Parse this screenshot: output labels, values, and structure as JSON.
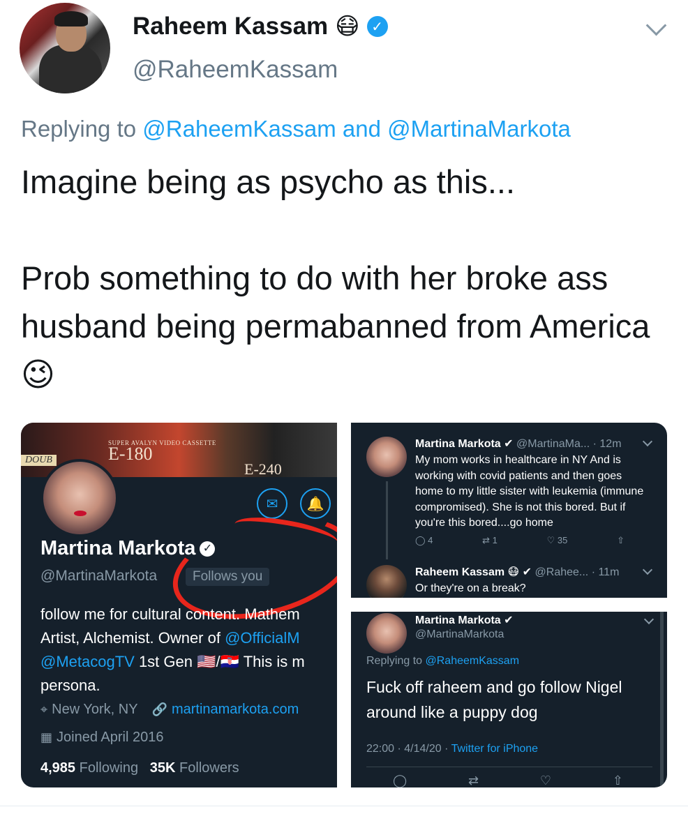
{
  "tweet": {
    "display_name": "Raheem Kassam",
    "name_emoji": "😷",
    "handle": "@RaheemKassam",
    "replying_prefix": "Replying to",
    "replying_mention_1": "@RaheemKassam",
    "replying_and": "and",
    "replying_mention_2": "@MartinaMarkota",
    "text_line_1": "Imagine being as psycho as this...",
    "text_line_2": "Prob something to do with her broke ass husband being permabanned from America 😉"
  },
  "profile_shot": {
    "banner_caption_small": "SUPER AVALYN VIDEO CASSETTE",
    "banner_caption_big": "E-180",
    "banner_caption_right": "E-240",
    "banner_caption_left": "DOUB",
    "name": "Martina Markota",
    "handle": "@MartinaMarkota",
    "follows_badge": "Follows you",
    "bio_line_1": "follow me for cultural content. Mathem",
    "bio_line_2a": "Artist, Alchemist. Owner of ",
    "bio_line_2b": "@OfficialM",
    "bio_line_3a": "@MetacogTV",
    "bio_line_3b": " 1st Gen 🇺🇸/🇭🇷  This is m",
    "bio_line_4": "persona.",
    "location": "New York, NY",
    "website": "martinamarkota.com",
    "joined": "Joined April 2016",
    "following_count": "4,985",
    "following_label": "Following",
    "followers_count": "35K",
    "followers_label": "Followers"
  },
  "thread_shot": {
    "tweet1_name": "Martina Markota",
    "tweet1_meta": "@MartinaMa... · 12m",
    "tweet1_text": "My mom works in healthcare in NY And is working with covid patients and then goes home to my little sister with leukemia (immune compromised). She is not this bored. But if you're this bored....go home",
    "reply_count": "4",
    "retweet_count": "1",
    "like_count": "35",
    "tweet2_name": "Raheem Kassam 😷",
    "tweet2_meta": "@Rahee... · 11m",
    "tweet2_text": "Or they're on a break?"
  },
  "detail_shot": {
    "name": "Martina Markota",
    "handle": "@MartinaMarkota",
    "replying_prefix": "Replying to",
    "replying_mention": "@RaheemKassam",
    "text": "Fuck off raheem and go follow Nigel around like a puppy dog",
    "timestamp": "22:00 · 4/14/20 ·",
    "client": "Twitter for iPhone"
  },
  "icons": {
    "verified": "verified-badge-icon",
    "chevron": "chevron-down-icon",
    "mail": "mail-icon",
    "bell": "notification-bell-icon",
    "location": "location-pin-icon",
    "link": "link-icon",
    "calendar": "calendar-icon",
    "reply": "reply-icon",
    "retweet": "retweet-icon",
    "like": "heart-icon",
    "share": "share-icon"
  },
  "colors": {
    "accent": "#1da1f2",
    "dark_bg": "#15202b",
    "annotation_red": "#e8261c",
    "muted": "#657786"
  }
}
